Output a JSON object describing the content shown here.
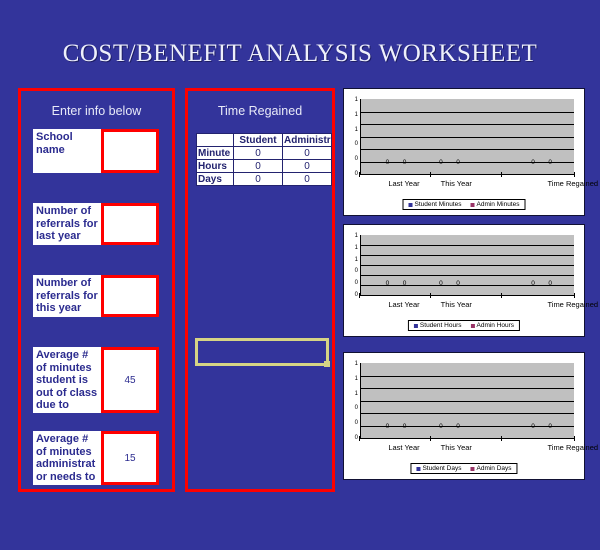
{
  "title": "COST/BENEFIT ANALYSIS WORKSHEET",
  "colors": {
    "background": "#33349b",
    "panel_border": "#ff0000",
    "title_text": "#eef0fb",
    "label_text": "#2b2b8f",
    "selection_border": "#d6d485",
    "plot_fill": "#c0c0c0",
    "series_student": "#333399",
    "series_admin": "#993366"
  },
  "input_panel": {
    "heading": "Enter info below",
    "rows": [
      {
        "label": "School name",
        "value": ""
      },
      {
        "label": "Number of\nreferrals for\nlast year",
        "value": ""
      },
      {
        "label": "Number of\nreferrals for\nthis year",
        "value": ""
      },
      {
        "label": "Average #\nof minutes\nstudent is\nout of class\ndue to",
        "value": "45"
      },
      {
        "label": "Average #\nof minutes\nadministrat\nor needs  to",
        "value": "15"
      }
    ]
  },
  "time_panel": {
    "heading": "Time Regained",
    "table": {
      "corner": "",
      "columns": [
        "Student",
        "Administrato"
      ],
      "rows": [
        {
          "label": "Minute",
          "values": [
            "0",
            "0"
          ]
        },
        {
          "label": "Hours",
          "values": [
            "0",
            "0"
          ]
        },
        {
          "label": "Days",
          "values": [
            "0",
            "0"
          ]
        }
      ]
    },
    "selected_cell_value": ""
  },
  "chart_data": [
    {
      "type": "bar",
      "title": "",
      "categories": [
        "Last Year",
        "This Year",
        "Time Regained"
      ],
      "series": [
        {
          "name": "Student Minutes",
          "values": [
            0,
            0,
            0
          ],
          "color": "#333399"
        },
        {
          "name": "Admin Minutes",
          "values": [
            0,
            0,
            0
          ],
          "color": "#993366"
        }
      ],
      "data_labels": [
        "0",
        "0",
        "0",
        "0",
        "0",
        "0"
      ],
      "yticks": [
        "1",
        "1",
        "1",
        "0",
        "0",
        "0"
      ],
      "ylim": [
        0,
        1.2
      ],
      "xlabel": "",
      "ylabel": "",
      "grid": true,
      "legend_position": "bottom"
    },
    {
      "type": "bar",
      "title": "",
      "categories": [
        "Last Year",
        "This Year",
        "Time Regained"
      ],
      "series": [
        {
          "name": "Student Hours",
          "values": [
            0,
            0,
            0
          ],
          "color": "#333399"
        },
        {
          "name": "Admin Hours",
          "values": [
            0,
            0,
            0
          ],
          "color": "#993366"
        }
      ],
      "data_labels": [
        "0",
        "0",
        "0",
        "0",
        "0",
        "0"
      ],
      "yticks": [
        "1",
        "1",
        "1",
        "0",
        "0",
        "0"
      ],
      "ylim": [
        0,
        1.2
      ],
      "xlabel": "",
      "ylabel": "",
      "grid": true,
      "legend_position": "bottom"
    },
    {
      "type": "bar",
      "title": "",
      "categories": [
        "Last Year",
        "This Year",
        "Time Regained"
      ],
      "series": [
        {
          "name": "Student Days",
          "values": [
            0,
            0,
            0
          ],
          "color": "#333399"
        },
        {
          "name": "Admin Days",
          "values": [
            0,
            0,
            0
          ],
          "color": "#993366"
        }
      ],
      "data_labels": [
        "0",
        "0",
        "0",
        "0",
        "0",
        "0"
      ],
      "yticks": [
        "1",
        "1",
        "1",
        "0",
        "0",
        "0"
      ],
      "ylim": [
        0,
        1.2
      ],
      "xlabel": "",
      "ylabel": "",
      "grid": true,
      "legend_position": "bottom"
    }
  ]
}
